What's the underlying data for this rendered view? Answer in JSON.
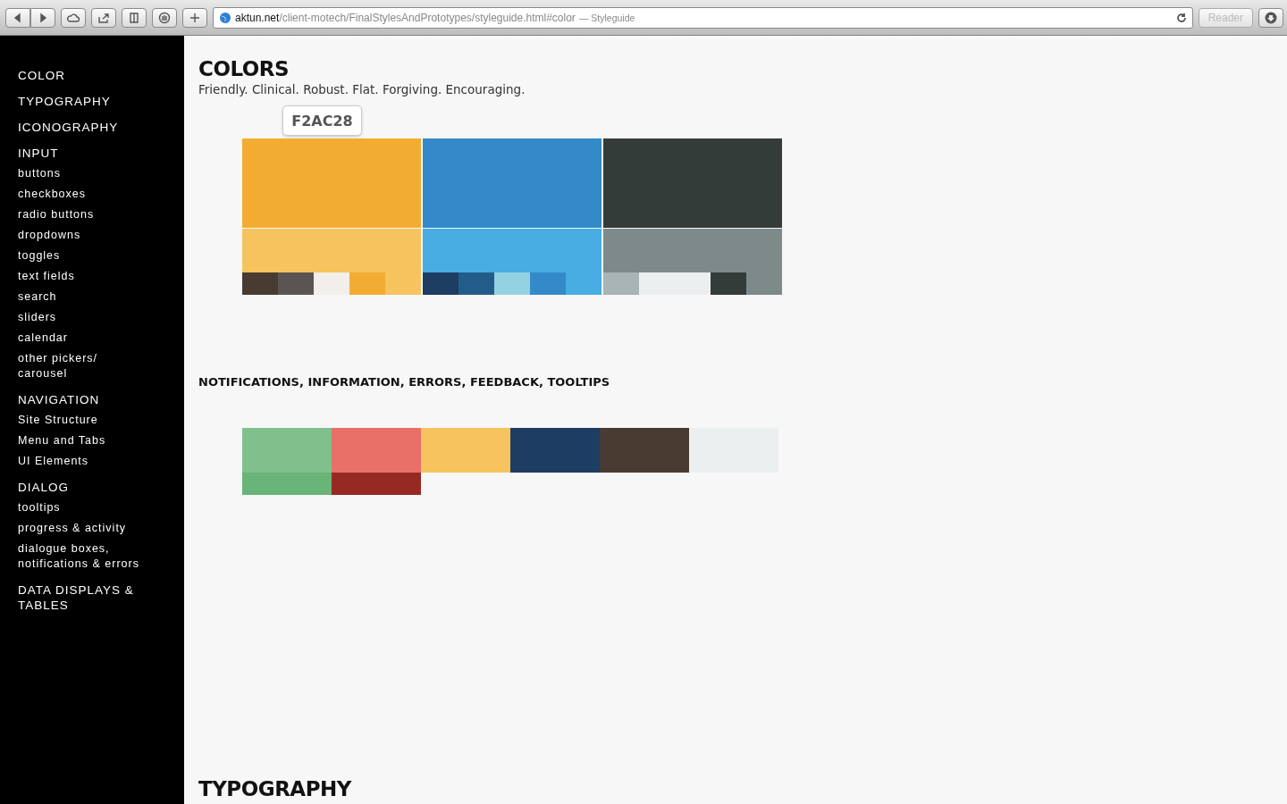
{
  "browser": {
    "url_host": "aktun.net",
    "url_path": "/client-motech/FinalStylesAndPrototypes/styleguide.html#color",
    "page_title": "— Styleguide",
    "reader": "Reader"
  },
  "sidebar": {
    "items": [
      {
        "label": "COLOR",
        "kind": "section"
      },
      {
        "label": "TYPOGRAPHY",
        "kind": "section"
      },
      {
        "label": "ICONOGRAPHY",
        "kind": "section"
      },
      {
        "label": "INPUT",
        "kind": "section"
      },
      {
        "label": "buttons",
        "kind": "item"
      },
      {
        "label": "checkboxes",
        "kind": "item"
      },
      {
        "label": "radio buttons",
        "kind": "item"
      },
      {
        "label": "dropdowns",
        "kind": "item"
      },
      {
        "label": "toggles",
        "kind": "item"
      },
      {
        "label": "text fields",
        "kind": "item"
      },
      {
        "label": "search",
        "kind": "item"
      },
      {
        "label": "sliders",
        "kind": "item"
      },
      {
        "label": "calendar",
        "kind": "item"
      },
      {
        "label": "other pickers/ carousel",
        "kind": "item"
      },
      {
        "label": "NAVIGATION",
        "kind": "section"
      },
      {
        "label": "Site Structure",
        "kind": "item"
      },
      {
        "label": "Menu and Tabs",
        "kind": "item"
      },
      {
        "label": "UI Elements",
        "kind": "item"
      },
      {
        "label": "DIALOG",
        "kind": "section"
      },
      {
        "label": "tooltips",
        "kind": "item"
      },
      {
        "label": "progress & activity",
        "kind": "item"
      },
      {
        "label": "dialogue boxes, notifications & errors",
        "kind": "item"
      },
      {
        "label": "DATA DISPLAYS & TABLES",
        "kind": "section"
      }
    ]
  },
  "colors": {
    "title": "COLORS",
    "subtitle": "Friendly. Clinical. Robust. Flat. Forgiving. Encouraging.",
    "tooltip": "F2AC28",
    "palettes": [
      {
        "main": {
          "color": "#f2ac32"
        },
        "light": {
          "color": "#f7c35e"
        },
        "swatches": [
          {
            "color": "#483c32",
            "kind": "single"
          },
          {
            "color": "#5a5552",
            "kind": "single"
          },
          {
            "color": "#f2eeea",
            "kind": "single"
          },
          {
            "color": "#f2ac32",
            "kind": "single"
          }
        ]
      },
      {
        "main": {
          "color": "#348ac8"
        },
        "light": {
          "color": "#47ade2"
        },
        "swatches": [
          {
            "color": "#1e3d62",
            "kind": "single"
          },
          {
            "color": "#225d8a",
            "kind": "single"
          },
          {
            "color": "#94d2e2",
            "kind": "single"
          },
          {
            "color": "#348ac8",
            "kind": "single"
          }
        ]
      },
      {
        "main": {
          "color": "#343c3a"
        },
        "light": {
          "color": "#7e8a8a"
        },
        "swatches": [
          {
            "color": "#a8b4b5",
            "kind": "single"
          },
          {
            "color": "#eceff0",
            "kind": "double"
          },
          {
            "color": "#343c3a",
            "kind": "single"
          }
        ]
      }
    ]
  },
  "notifications": {
    "title": "NOTIFICATIONS, INFORMATION, ERRORS, FEEDBACK, TOOLTIPS",
    "swatches": [
      {
        "color": "#7fc08c"
      },
      {
        "color": "#e87068"
      },
      {
        "color": "#f7c35e"
      },
      {
        "color": "#1e3d62"
      },
      {
        "color": "#483c32"
      },
      {
        "color": "#eceff0"
      }
    ],
    "shades": [
      {
        "color": "#69b478"
      },
      {
        "color": "#962a22"
      }
    ]
  },
  "typography": {
    "title": "TYPOGRAPHY"
  }
}
